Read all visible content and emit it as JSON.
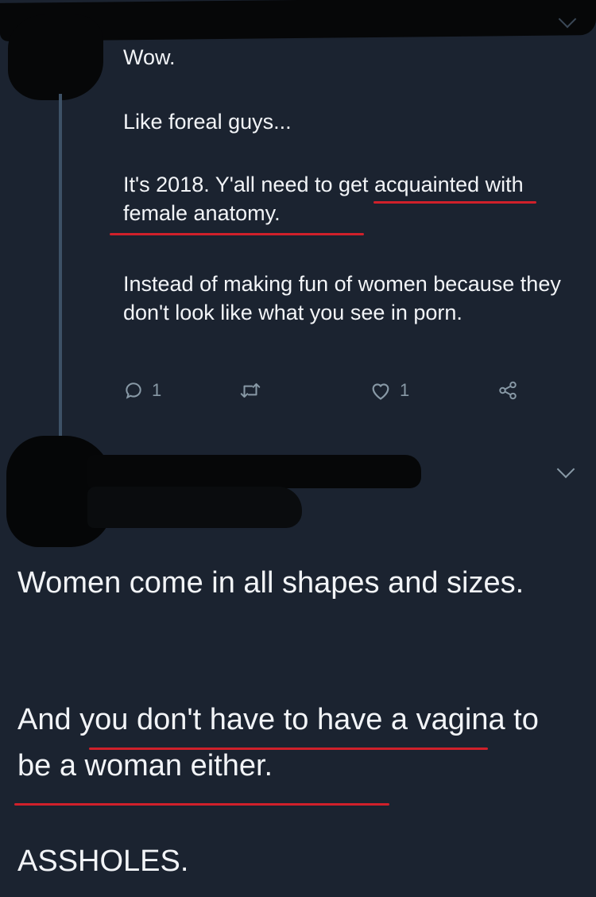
{
  "tweet1": {
    "paragraphs": {
      "wow": "Wow.",
      "foreal": "Like foreal guys...",
      "year": "It's 2018. Y'all need to get acquainted with female anatomy.",
      "instead": "Instead of making fun of women because they don't look like what you see in porn."
    },
    "actions": {
      "reply_count": "1",
      "retweet_count": "",
      "like_count": "1"
    }
  },
  "tweet2": {
    "paragraphs": {
      "shapes": "Women come in all shapes and sizes.",
      "vagina": "And you don't have to have a vagina to be a woman either.",
      "assholes": "ASSHOLES."
    }
  },
  "colors": {
    "background": "#1b2330",
    "text": "#f2f4f7",
    "icon": "#8899a6",
    "annotation_red": "#d0202a",
    "redaction": "#060708"
  },
  "icons": {
    "reply": "reply-icon",
    "retweet": "retweet-icon",
    "like": "heart-icon",
    "share": "share-icon",
    "more": "chevron-down-icon"
  }
}
